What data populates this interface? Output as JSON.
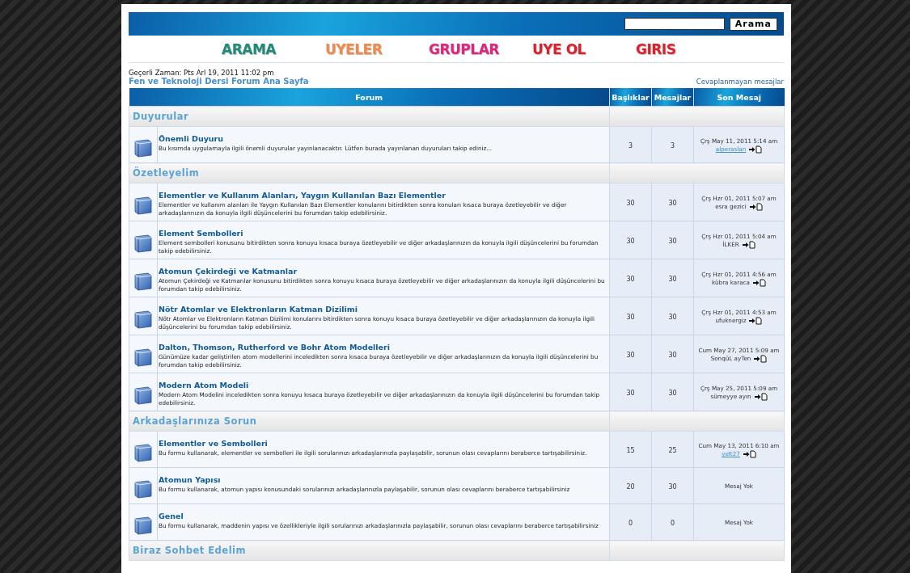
{
  "header": {
    "search_button": "Arama"
  },
  "nav": [
    {
      "label": "ARAMA",
      "color": "#1f8a78"
    },
    {
      "label": "UYELER",
      "color": "#f08a4b"
    },
    {
      "label": "GRUPLAR",
      "color": "#e0247c"
    },
    {
      "label": "UYE OL",
      "color": "#e01e2a"
    },
    {
      "label": "GIRIS",
      "color": "#e01e2a"
    }
  ],
  "current_time": "Geçerli Zaman: Pts Arl 19, 2011 11:02 pm",
  "breadcrumb": "Fen ve Teknoloji Dersi Forum Ana Sayfa",
  "unanswered_link": "Cevaplanmayan mesajlar",
  "table": {
    "columns": [
      "Forum",
      "Başlıklar",
      "Mesajlar",
      "Son Mesaj"
    ],
    "categories": [
      {
        "title": "Duyurular",
        "forums": [
          {
            "title": "Önemli Duyuru",
            "description": "Bu kısımda uygulamayla ilgili önemli duyurular yayınlanacaktır. Lütfen burada yayınlanan duyuruları takip ediniz...",
            "topics": "3",
            "posts": "3",
            "last_post": {
              "kind": "post",
              "date": "Çrş May 11, 2011 5:14 am",
              "author": "alperaslan",
              "author_linked": true
            }
          }
        ]
      },
      {
        "title": "Özetleyelim",
        "forums": [
          {
            "title": "Elementler ve Kullanım Alanları, Yaygın Kullanılan Bazı Elementler",
            "description": "Elementler ve kullanım alanları ile Yaygın Kullanılan Bazı Elementler konularını bitirdikten sonra konuları kısaca buraya özetleyebilir ve diğer arkadaşlarınızın da konuyla ilgili düşüncelerini bu forumdan takip edebilirsiniz.",
            "topics": "30",
            "posts": "30",
            "last_post": {
              "kind": "post",
              "date": "Çrş Hzr 01, 2011 5:07 am",
              "author": "esra gezici",
              "author_linked": false
            }
          },
          {
            "title": "Element Sembolleri",
            "description": "Element sembolleri konusunu bitirdikten sonra konuyu kısaca buraya özetleyebilir ve diğer arkadaşlarınızın da konuyla ilgili düşüncelerini bu forumdan takip edebilirsiniz.",
            "topics": "30",
            "posts": "30",
            "last_post": {
              "kind": "post",
              "date": "Çrş Hzr 01, 2011 5:04 am",
              "author": "İLKER",
              "author_linked": false
            }
          },
          {
            "title": "Atomun Çekirdeği ve Katmanlar",
            "description": "Atomun Çekirdeği ve Katmanlar konusunu bitirdikten sonra konuyu kısaca buraya özetleyebilir ve diğer arkadaşlarınızın da konuyla ilgili düşüncelerini bu forumdan takip edebilirsiniz.",
            "topics": "30",
            "posts": "30",
            "last_post": {
              "kind": "post",
              "date": "Çrş Hzr 01, 2011 4:56 am",
              "author": "kübra karaca",
              "author_linked": false
            }
          },
          {
            "title": "Nötr Atomlar ve Elektronların Katman Dizilimi",
            "description": "Nötr Atomlar ve Elektronların Katman Dizilimi konularını bitirdikten sonra konuyu kısaca buraya özetleyebilir ve diğer arkadaşlarınızın da konuyla ilgili düşüncelerini bu forumdan takip edebilirsiniz.",
            "topics": "30",
            "posts": "30",
            "last_post": {
              "kind": "post",
              "date": "Çrş Hzr 01, 2011 4:53 am",
              "author": "ufuknergiz",
              "author_linked": false
            }
          },
          {
            "title": "Dalton, Thomson, Rutherford ve Bohr Atom Modelleri",
            "description": "Günümüze kadar geliştirilen atom modellerini inceledikten sonra kısaca buraya özetleyebilir ve diğer arkadaşlarınızın da konuyla ilgili düşüncelerini bu forumdan takip edebilirsiniz.",
            "topics": "30",
            "posts": "30",
            "last_post": {
              "kind": "post",
              "date": "Cum May 27, 2011 5:09 am",
              "author": "SonqüL ayTen",
              "author_linked": false
            }
          },
          {
            "title": "Modern Atom Modeli",
            "description": "Modern Atom Modelini inceledikten sonra konuyu kısaca buraya özetleyebilir ve diğer arkadaşlarınızın da konuyla ilgili düşüncelerini bu forumdan takip edebilirsiniz.",
            "topics": "30",
            "posts": "30",
            "last_post": {
              "kind": "post",
              "date": "Çrş May 25, 2011 5:09 am",
              "author": "sümeyye ayın",
              "author_linked": false
            }
          }
        ]
      },
      {
        "title": "Arkadaşlarınıza Sorun",
        "forums": [
          {
            "title": "Elementler ve Sembolleri",
            "description": "Bu formu kullanarak, elementler ve sembolleri ile ilgili sorularınızı arkadaşlarınızla paylaşabilir, sorunun olası cevaplarını beraberce tartışabilirsiniz.",
            "topics": "15",
            "posts": "25",
            "last_post": {
              "kind": "post",
              "date": "Cum May 13, 2011 6:10 am",
              "author": "yelt27",
              "author_linked": true
            }
          },
          {
            "title": "Atomun Yapısı",
            "description": "Bu formu kullanarak, atomun yapısı konusundaki sorularınızı arkadaşlarınızla paylaşabilir, sorunun olası cevaplarını beraberce tartışabilirsiniz",
            "topics": "20",
            "posts": "30",
            "last_post": {
              "kind": "none",
              "text": "Mesaj Yok"
            }
          },
          {
            "title": "Genel",
            "description": "Bu formu kullanarak, maddenin yapısı ve özellikleriyle ilgili sorularınızı arkadaşlarınızla paylaşabilir, sorunun olası cevaplarını beraberce tartışabilirsiniz",
            "topics": "0",
            "posts": "0",
            "last_post": {
              "kind": "none",
              "text": "Mesaj Yok"
            }
          }
        ]
      },
      {
        "title": "Biraz Sohbet Edelim"
      }
    ]
  }
}
